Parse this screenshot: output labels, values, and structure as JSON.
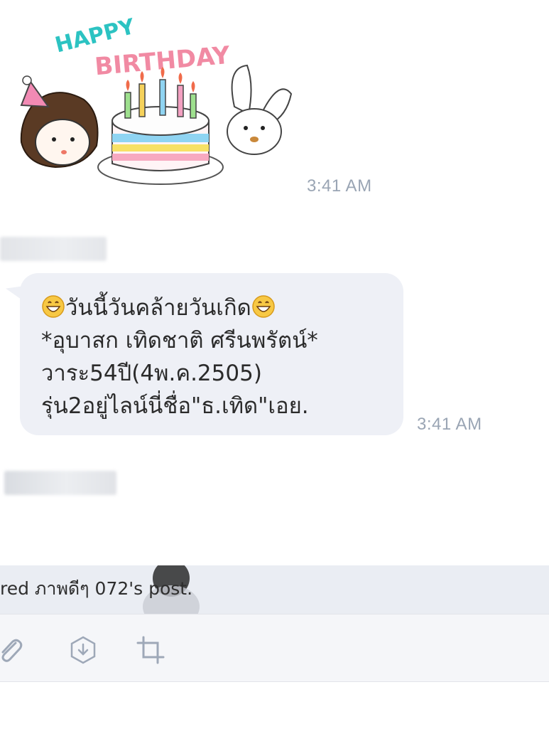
{
  "sticker": {
    "text_line1": "HAPPY",
    "text_line2": "BIRTHDAY",
    "time": "3:41 AM"
  },
  "message": {
    "sender_blurred": "",
    "lines": [
      "วันนี้วันคล้ายวันเกิด",
      "*อุบาสก เทิดชาติ ศรีนพรัตน์*",
      "วาระ54ปี(4พ.ค.2505)",
      "รุ่น2อยู่ไลน์นี่ชื่อ\"ธ.เทิด\"เอย."
    ],
    "time": "3:41 AM"
  },
  "next_sender_blurred": "",
  "share": {
    "text": "red ภาพดีๆ 072's post."
  },
  "toolbar": {
    "icons": [
      "paperclip-icon",
      "download-circle-icon",
      "crop-icon"
    ]
  },
  "colors": {
    "bubble": "#eef0f6",
    "timestamp": "#9aa5b4",
    "share_bar": "#eaedf3",
    "toolbar_bg": "#f5f6f9",
    "icon": "#9ea8b8"
  }
}
